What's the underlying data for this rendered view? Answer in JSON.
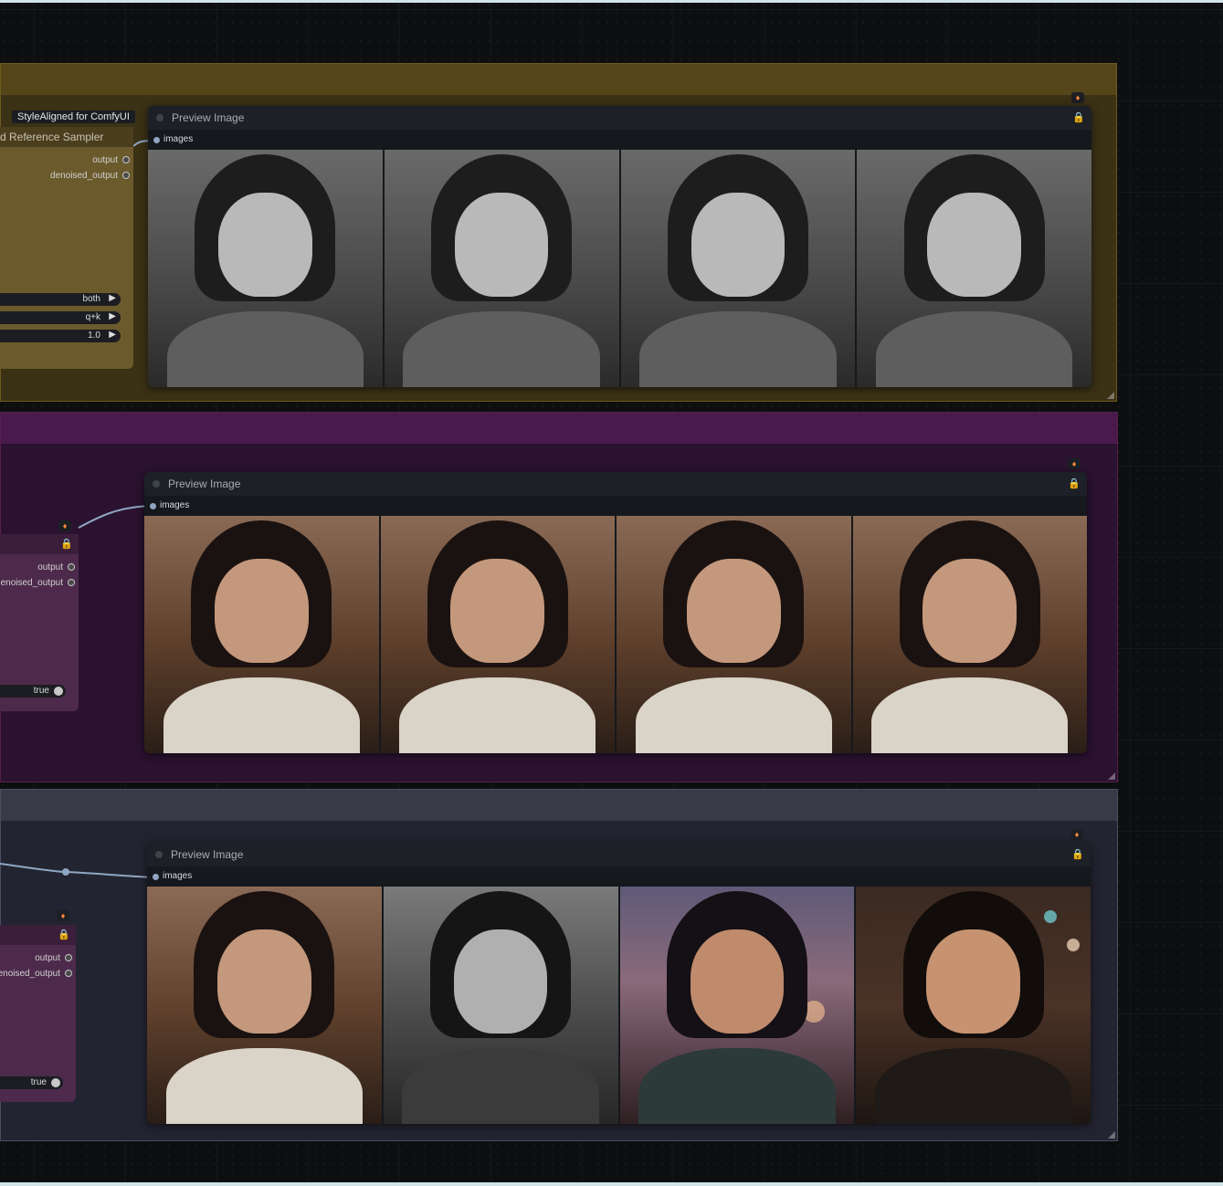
{
  "group_badge": "StyleAligned for ComfyUI",
  "sampler_title": "d Reference Sampler",
  "outputs": {
    "output": "output",
    "denoised_output": "denoised_output",
    "denoised_output_cut": "enoised_output"
  },
  "widgets": {
    "share": "both",
    "share_attn": "q+k",
    "scale": "1.0",
    "toggle_value": "true"
  },
  "preview_nodes": [
    {
      "title": "Preview Image",
      "input_label": "images",
      "style": "black-and-white"
    },
    {
      "title": "Preview Image",
      "input_label": "images",
      "style": "warm-sunset"
    },
    {
      "title": "Preview Image",
      "input_label": "images",
      "style": "mixed"
    }
  ],
  "colors": {
    "group1": "#3b3115",
    "group2": "#2b1230",
    "group3": "#232431",
    "lock": "#f5c518",
    "link": "#8fa6c3"
  },
  "icons": [
    "lock-icon",
    "fox-icon",
    "slot-dot-icon",
    "triangle-right-icon",
    "toggle-knob-icon"
  ]
}
